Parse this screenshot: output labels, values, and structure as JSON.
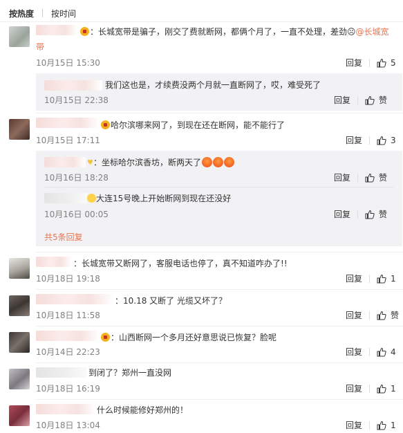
{
  "tabs": [
    "按热度",
    "按时间"
  ],
  "comments": [
    {
      "text": "：长城宽带是骗子，刚交了费就断网，都俩个月了，一直不处理，差劲",
      "mention": "@长城宽",
      "wrap": "带",
      "time": "10月15日 15:30",
      "reply": "回复",
      "likes": "5"
    },
    {
      "text": "哈尔滨哪来网了，到现在还在断网，能不能行了",
      "time": "10月15日 17:11",
      "reply": "回复",
      "likes": "3"
    },
    {
      "text": "：长城宽带又断网了，客服电话也停了，真不知道咋办了!!",
      "time": "10月18日 19:18",
      "reply": "回复",
      "likes": "1"
    },
    {
      "text": "：10.18 又断了 光缆又坏了？",
      "time": "10月18日 11:58",
      "reply": "回复",
      "likes": "赞"
    },
    {
      "text": "：山西断网一个多月还好意思说已恢复？脸呢",
      "time": "10月14日 22:23",
      "reply": "回复",
      "likes": "4"
    },
    {
      "text": "到闭了？郑州一直没网",
      "time": "10月18日 16:19",
      "reply": "回复",
      "likes": "1"
    },
    {
      "text": "什么时候能修好郑州的！",
      "time": "10月18日 13:04",
      "reply": "回复",
      "likes": "1"
    }
  ],
  "subreplies": [
    {
      "text": "我们这也是，才续费没两个月就一直断网了，哎，难受死了",
      "time": "10月15日 22:38",
      "reply": "回复",
      "likes": "赞"
    },
    {
      "text": "：坐标哈尔滨香坊，断两天了",
      "time": "10月16日 18:28",
      "reply": "回复",
      "likes": "赞"
    },
    {
      "text": "大连15号晚上开始断网到现在还没好",
      "time": "10月16日 00:05",
      "reply": "回复",
      "likes": "赞"
    }
  ],
  "more_replies": "共5条回复",
  "colors": {
    "link": "#eb7350",
    "subbox": "#f2f2f5",
    "time": "#808080"
  }
}
